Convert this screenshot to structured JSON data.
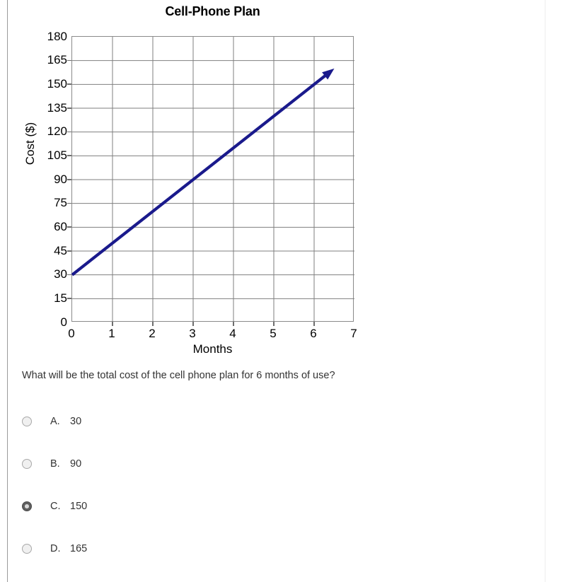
{
  "chart_data": {
    "type": "line",
    "title": "Cell-Phone Plan",
    "xlabel": "Months",
    "ylabel": "Cost ($)",
    "xlim": [
      0,
      7
    ],
    "ylim": [
      0,
      180
    ],
    "grid": true,
    "legend": false,
    "x_ticks": [
      0,
      1,
      2,
      3,
      4,
      5,
      6,
      7
    ],
    "y_ticks": [
      0,
      15,
      30,
      45,
      60,
      75,
      90,
      105,
      120,
      135,
      150,
      165,
      180
    ],
    "line_color": "#1a1a8c",
    "series": [
      {
        "name": "Cost",
        "intercept": 30,
        "slope": 20,
        "arrow_end": true,
        "x": [
          0,
          1,
          2,
          3,
          4,
          5,
          6,
          6.5
        ],
        "values": [
          30,
          50,
          70,
          90,
          110,
          130,
          150,
          160
        ]
      }
    ]
  },
  "question": {
    "text": "What will be the total cost of the cell phone plan for 6 months of use?"
  },
  "options": [
    {
      "letter": "A.",
      "value": "30",
      "selected": false
    },
    {
      "letter": "B.",
      "value": "90",
      "selected": false
    },
    {
      "letter": "C.",
      "value": "150",
      "selected": true
    },
    {
      "letter": "D.",
      "value": "165",
      "selected": false
    }
  ]
}
